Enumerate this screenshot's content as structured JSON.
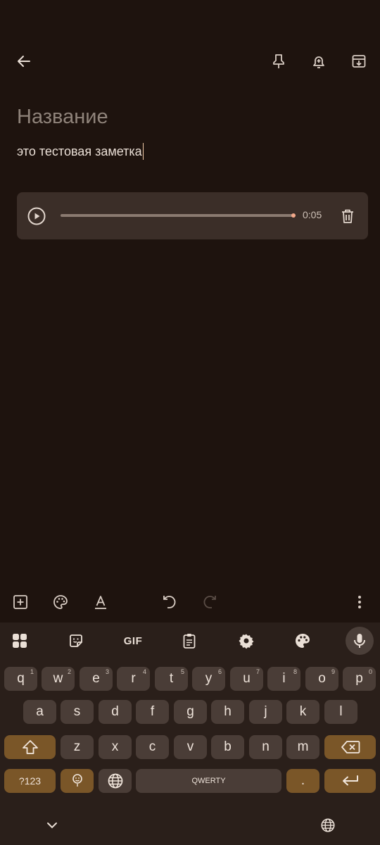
{
  "header": {
    "back_icon": "arrow-left-icon",
    "pin_icon": "pin-icon",
    "reminder_icon": "bell-plus-icon",
    "archive_icon": "archive-icon"
  },
  "note": {
    "title_placeholder": "Название",
    "body": "это тестовая заметка"
  },
  "audio": {
    "duration": "0:05",
    "progress": 1.0,
    "play_icon": "play-circle-icon",
    "delete_icon": "trash-icon"
  },
  "editor_toolbar": {
    "icons": [
      "add-box-icon",
      "palette-icon",
      "text-format-icon",
      "undo-icon",
      "redo-icon",
      "more-vert-icon"
    ]
  },
  "keyboard": {
    "toolbar_icons": [
      "apps-grid-icon",
      "sticker-icon",
      "gif-icon",
      "clipboard-icon",
      "settings-icon",
      "palette-icon",
      "mic-icon"
    ],
    "gif_label": "GIF",
    "row1": [
      {
        "k": "q",
        "h": "1"
      },
      {
        "k": "w",
        "h": "2"
      },
      {
        "k": "e",
        "h": "3"
      },
      {
        "k": "r",
        "h": "4"
      },
      {
        "k": "t",
        "h": "5"
      },
      {
        "k": "y",
        "h": "6"
      },
      {
        "k": "u",
        "h": "7"
      },
      {
        "k": "i",
        "h": "8"
      },
      {
        "k": "o",
        "h": "9"
      },
      {
        "k": "p",
        "h": "0"
      }
    ],
    "row2": [
      "a",
      "s",
      "d",
      "f",
      "g",
      "h",
      "j",
      "k",
      "l"
    ],
    "row3": [
      "z",
      "x",
      "c",
      "v",
      "b",
      "n",
      "m"
    ],
    "symbols_label": "?123",
    "space_label": "QWERTY",
    "period_label": "."
  },
  "navbar": {
    "hide_icon": "chevron-down-icon",
    "language_icon": "globe-icon"
  },
  "colors": {
    "background": "#1e130e",
    "card": "#3b2e28",
    "accent_key": "#7a5628",
    "progress_dot": "#f3a88a"
  }
}
